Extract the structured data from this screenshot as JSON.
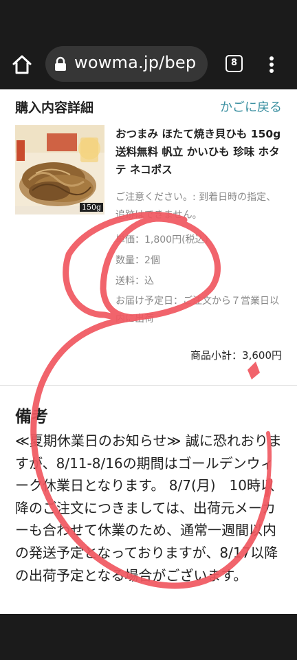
{
  "browser": {
    "url": "wowma.jp/bep",
    "tab_count": "8"
  },
  "order": {
    "section_title": "購入内容詳細",
    "back_link": "かごに戻る",
    "product_name": "おつまみ ほたて焼き貝ひも 150g 送料無料 帆立 かいひも 珍味 ホタテ ネコポス",
    "thumb_badge": "150g",
    "notice": "ご注意ください。: 到着日時の指定、追跡はできません。",
    "unit_price": "単価：1,800円(税込)",
    "quantity": "数量：2個",
    "shipping": "送料：込",
    "delivery": "お届け予定日：ご注文から７営業日以内に出荷",
    "subtotal": "商品小計：3,600円"
  },
  "remarks": {
    "title": "備考",
    "body": "≪夏期休業日のお知らせ≫ 誠に恐れおりますが、8/11-8/16の期間はゴールデンウィーク休業日となります。 8/7(月)　10時以降のご注文につきましては、出荷元メーカーも合わせて休業のため、通常一週間以内の発送予定となっておりますが、8/17以降の出荷予定となる場合がございます。"
  },
  "colors": {
    "link": "#3a8fa0",
    "annotation": "#f0575f"
  },
  "icons": [
    "home-icon",
    "lock-icon",
    "tab-switcher-icon",
    "more-vert-icon"
  ]
}
